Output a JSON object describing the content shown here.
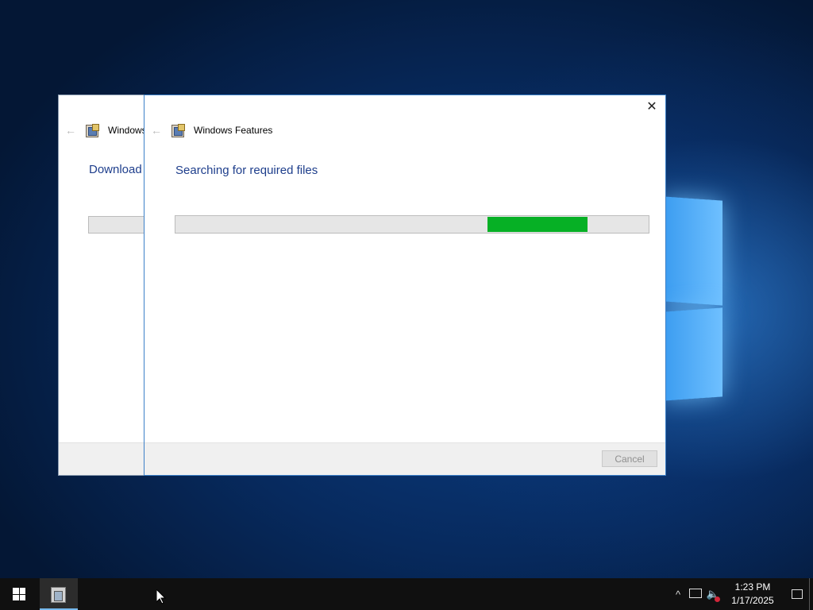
{
  "back_window": {
    "title": "Windows",
    "heading": "Download"
  },
  "dialog": {
    "title": "Windows Features",
    "heading": "Searching for required files",
    "progress": {
      "mode": "marquee",
      "chunk_start_fraction": 0.66,
      "chunk_end_fraction": 0.87
    },
    "cancel_label": "Cancel",
    "close_glyph": "✕",
    "back_glyph": "←"
  },
  "taskbar": {
    "start_icon": "windows-start-icon",
    "app_icon": "windows-features-icon",
    "tray": {
      "chevron": "^",
      "clock_time": "1:23 PM",
      "clock_date": "1/17/2025"
    }
  },
  "colors": {
    "progress_fill": "#06b025",
    "heading_text": "#1e3e8c",
    "desktop_blue": "#072a5e"
  }
}
